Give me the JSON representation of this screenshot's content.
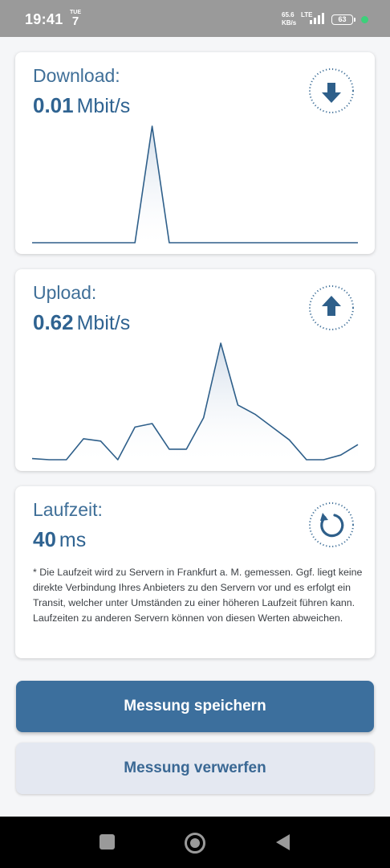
{
  "status_bar": {
    "time": "19:41",
    "day_of_week": "TUE",
    "day": "7",
    "net_speed_value": "65.6",
    "net_speed_unit": "KB/s",
    "network": "LTE",
    "battery": "63"
  },
  "download": {
    "title": "Download:",
    "value": "0.01",
    "unit": "Mbit/s",
    "icon": "arrow-down-icon"
  },
  "upload": {
    "title": "Upload:",
    "value": "0.62",
    "unit": "Mbit/s",
    "icon": "arrow-up-icon"
  },
  "latency": {
    "title": "Laufzeit:",
    "value": "40",
    "unit": "ms",
    "icon": "refresh-icon",
    "note": "* Die Laufzeit wird zu Servern in Frankfurt a. M. gemessen. Ggf. liegt keine direkte Verbindung Ihres Anbieters zu den Servern vor und es erfolgt ein Transit, welcher unter Umständen zu einer höheren Laufzeit führen kann. Laufzeiten zu anderen Servern können von diesen Werten abweichen."
  },
  "buttons": {
    "save": "Messung speichern",
    "discard": "Messung verwerfen"
  },
  "colors": {
    "primary": "#3c6f9d",
    "text": "#2f6391",
    "line": "#2e5f8a",
    "secondary_bg": "#e4e8f1"
  },
  "chart_data": [
    {
      "type": "area",
      "name": "download",
      "values": [
        0,
        0,
        0,
        0,
        0,
        0,
        0,
        0.01,
        0,
        0,
        0,
        0,
        0,
        0,
        0,
        0,
        0,
        0,
        0,
        0
      ],
      "ylim": [
        0,
        0.01
      ]
    },
    {
      "type": "area",
      "name": "upload",
      "values": [
        0.01,
        0,
        0,
        0.18,
        0.16,
        0,
        0.28,
        0.31,
        0.09,
        0.09,
        0.36,
        1.0,
        0.47,
        0.39,
        0.28,
        0.17,
        0,
        0,
        0.04,
        0.13
      ],
      "ylim": [
        0,
        1.0
      ]
    }
  ]
}
